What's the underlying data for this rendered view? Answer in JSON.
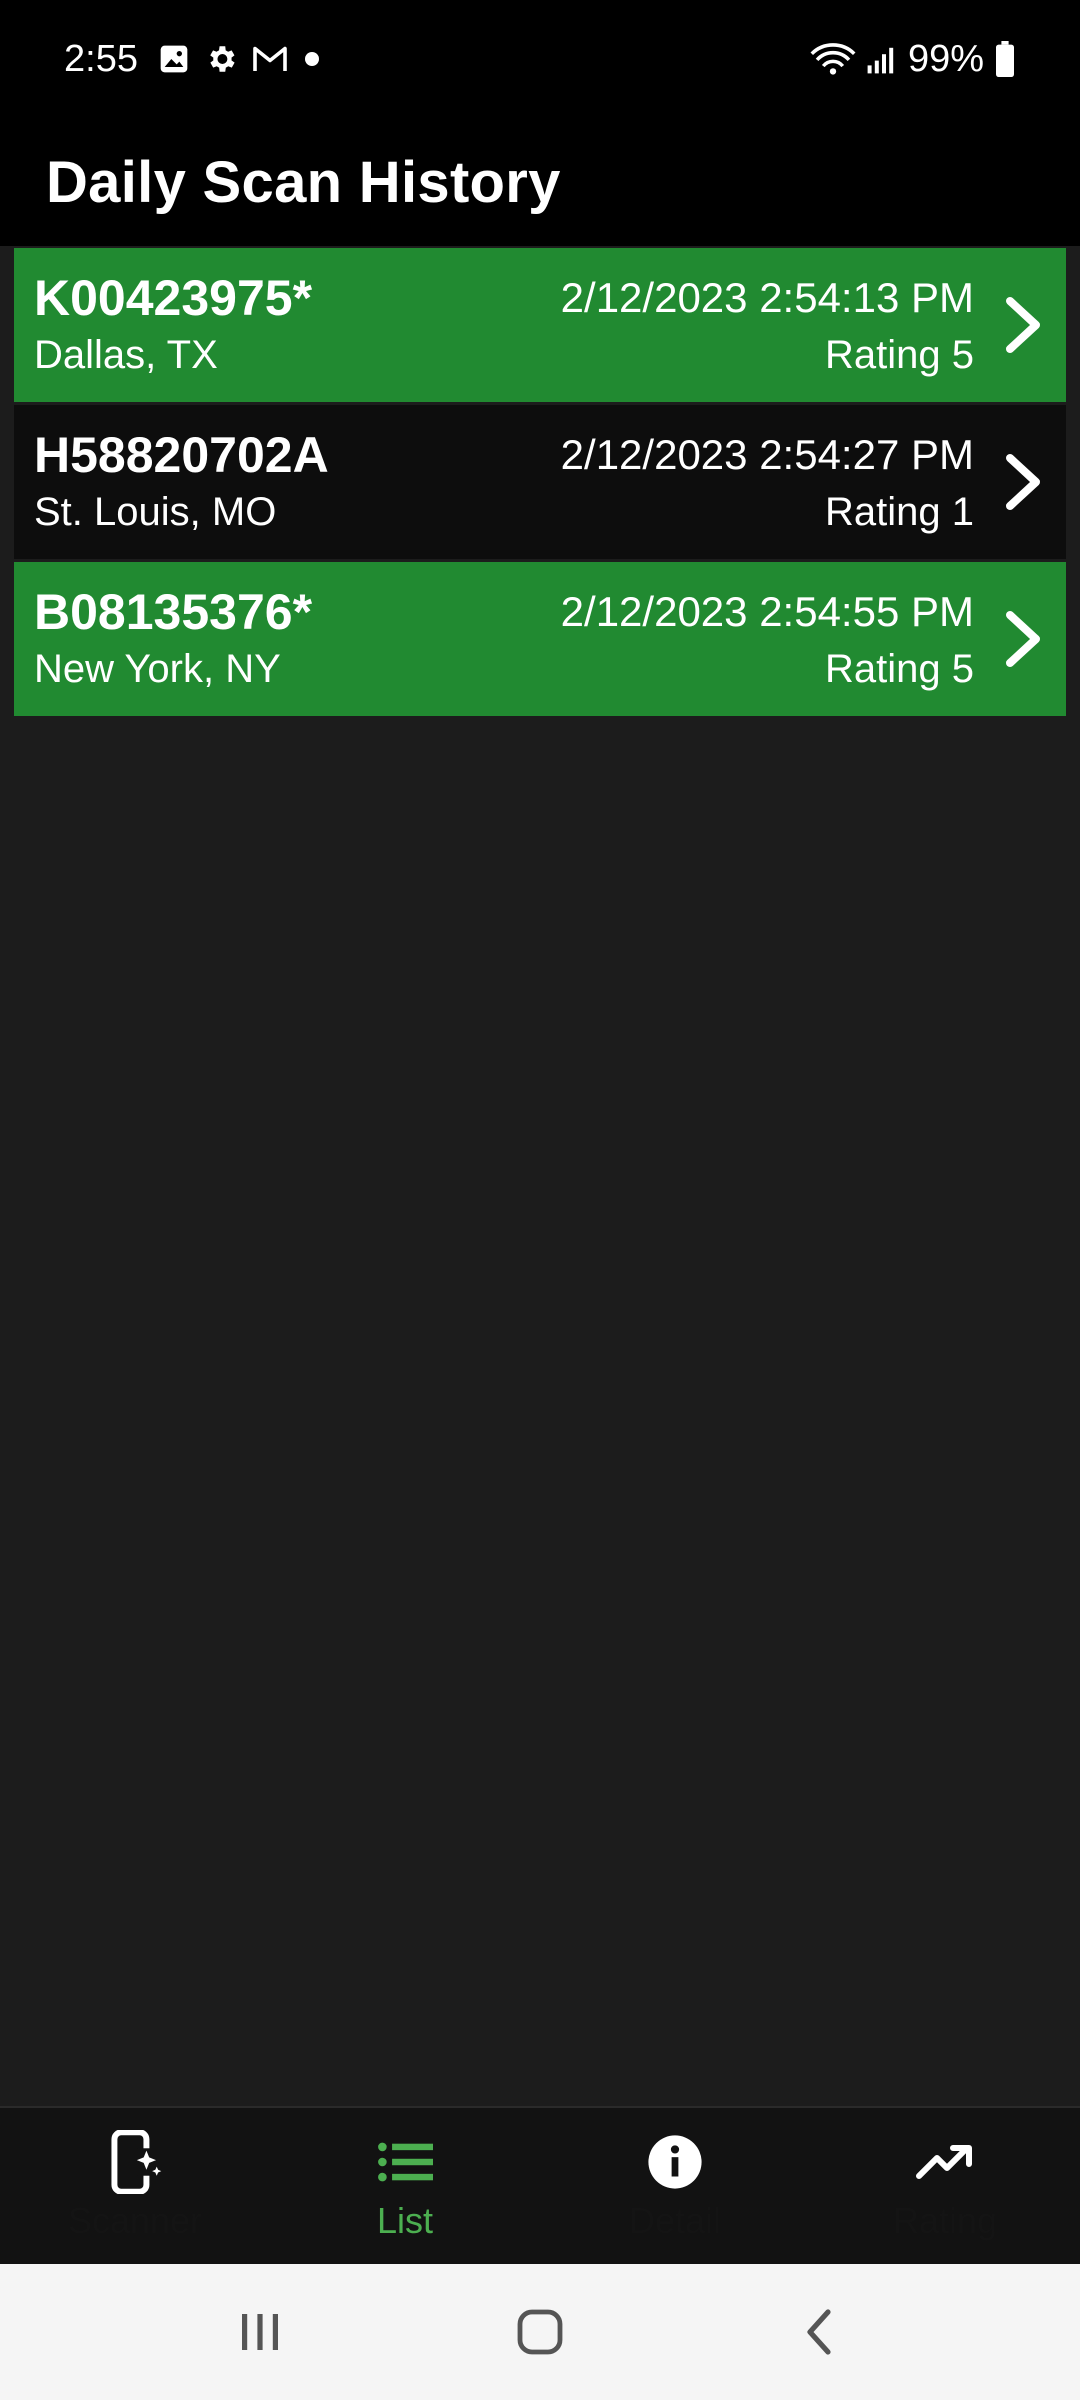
{
  "status_bar": {
    "time": "2:55",
    "battery": "99%",
    "icons_left": [
      "gallery-icon",
      "settings-icon",
      "gmail-icon",
      "dot-icon"
    ],
    "icons_right": [
      "wifi-icon",
      "signal-icon",
      "battery-icon"
    ]
  },
  "app_bar": {
    "title": "Daily Scan History"
  },
  "scans": [
    {
      "code": "K00423975*",
      "location": "Dallas, TX",
      "timestamp": "2/12/2023 2:54:13 PM",
      "rating": "Rating 5",
      "status": "good",
      "color": "#218a31"
    },
    {
      "code": "H58820702A",
      "location": "St. Louis, MO",
      "timestamp": "2/12/2023 2:54:27 PM",
      "rating": "Rating 1",
      "status": "bad",
      "color": "#0d0d0d"
    },
    {
      "code": "B08135376*",
      "location": "New York, NY",
      "timestamp": "2/12/2023 2:54:55 PM",
      "rating": "Rating 5",
      "status": "good",
      "color": "#218a31"
    }
  ],
  "bottom_nav": {
    "items": [
      {
        "label": "Scanner",
        "icon": "scanner-phone-icon",
        "active": false
      },
      {
        "label": "List",
        "icon": "list-icon",
        "active": true
      },
      {
        "label": "Detail",
        "icon": "info-icon",
        "active": false
      },
      {
        "label": "Rating",
        "icon": "trending-up-icon",
        "active": false
      }
    ],
    "active_color": "#4caf50"
  },
  "system_nav": {
    "buttons": [
      "recents-icon",
      "home-icon",
      "back-icon"
    ]
  }
}
